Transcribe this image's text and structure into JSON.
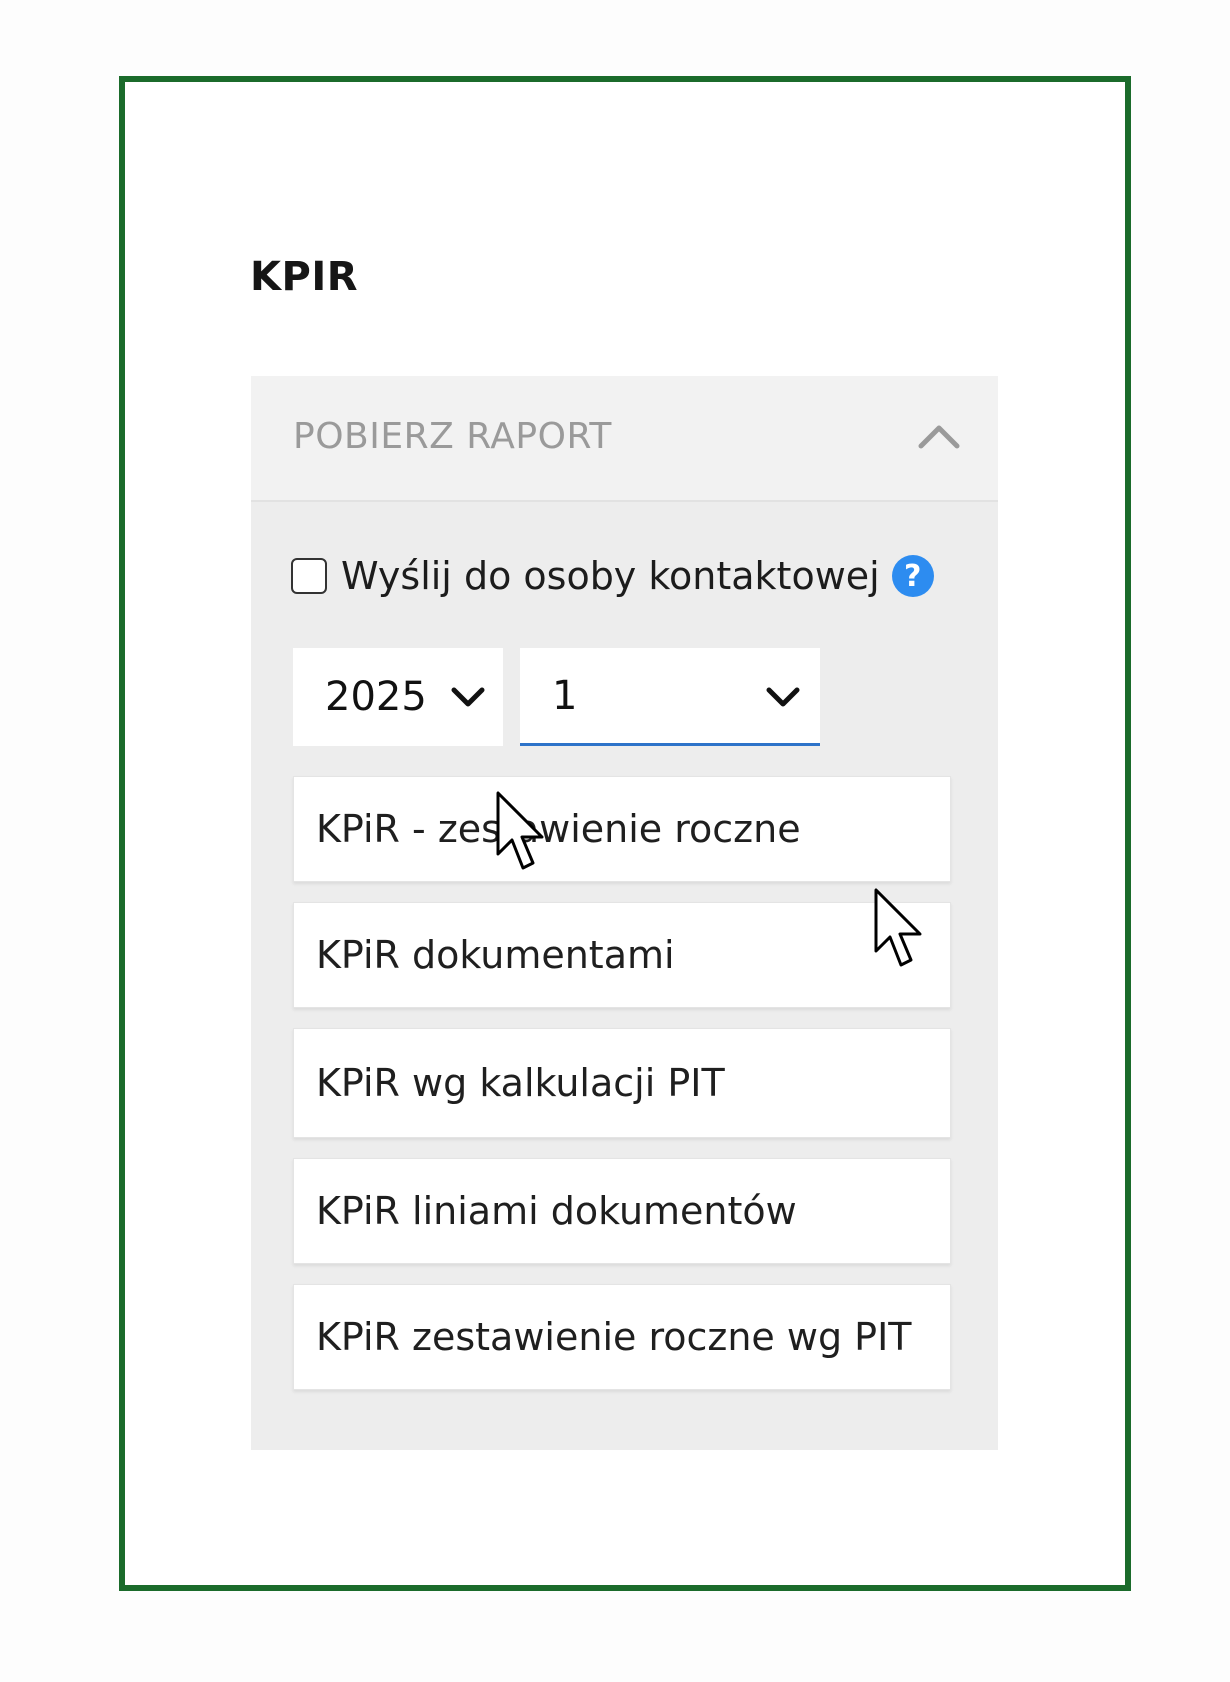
{
  "page": {
    "title": "KPIR"
  },
  "panel": {
    "header_label": "POBIERZ RAPORT",
    "expanded": true
  },
  "send_to_contact": {
    "label": "Wyślij do osoby kontaktowej",
    "checked": false,
    "help_icon": "question-mark-icon",
    "help_glyph": "?"
  },
  "filters": {
    "year": "2025",
    "month": "1"
  },
  "reports": [
    "KPiR - zestawienie roczne",
    "KPiR dokumentami",
    "KPiR wg kalkulacji PIT",
    "KPiR liniami dokumentów",
    "KPiR zestawienie roczne wg PIT"
  ],
  "colors": {
    "frame_border": "#1b6b2b",
    "panel_bg": "#ededed",
    "header_text": "#9a9a9a",
    "help_icon": "#2d8cf0",
    "select_focus_underline": "#2d73c9"
  }
}
